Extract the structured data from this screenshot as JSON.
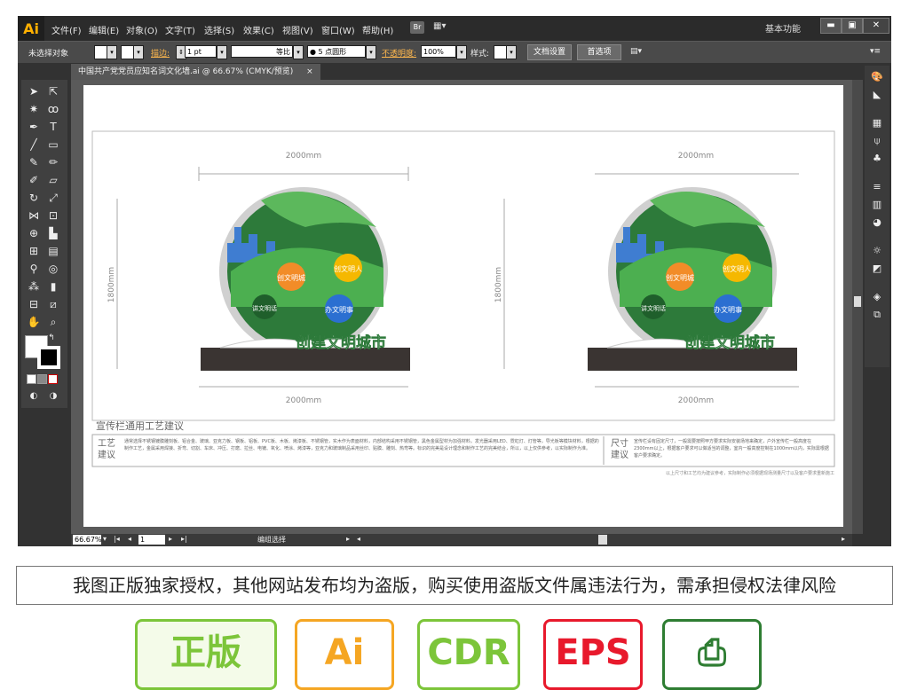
{
  "menubar": {
    "logo": "Ai",
    "items": [
      "文件(F)",
      "编辑(E)",
      "对象(O)",
      "文字(T)",
      "选择(S)",
      "效果(C)",
      "视图(V)",
      "窗口(W)",
      "帮助(H)"
    ],
    "br": "Br",
    "workspace": "基本功能",
    "minimize": "▬",
    "maximize": "▣",
    "close": "✕"
  },
  "control": {
    "selection_label": "未选择对象",
    "stroke_label": "描边:",
    "stroke_weight": "1 pt",
    "stroke_profile": "等比",
    "brush": "5 点圆形",
    "opacity_label": "不透明度:",
    "opacity_value": "100%",
    "style_label": "样式:",
    "doc_setup": "文档设置",
    "preferences": "首选项"
  },
  "tab": {
    "title": "中国共产党党员应知名词文化墙.ai @ 66.67% (CMYK/预览)",
    "close": "×"
  },
  "artwork": {
    "dim_width": "2000mm",
    "dim_height": "1800mm",
    "slogan": "创建文明城市",
    "circle_labels": [
      "创文明城",
      "创文明人",
      "讲文明话",
      "办文明事"
    ],
    "section_title": "宣传栏通用工艺建议",
    "craft_label": "工艺建议",
    "craft_text": "通常选择不锈钢镀膜雕刻板、铝合金、玻璃、亚克力板、钢板、铝板、PVC板、木板、烤漆板、不锈钢管，实木作为表面材料，内部结构采用不锈钢管，黑色金属型材为加强材料。发光器采用LED、霓虹灯、灯管等，导光板等模块材料，根据的制作工艺，金属采用焊接、折弯、切割、车床、冲压、打磨、拉丝、电镀、氧化、喷涂、烤漆等，亚克力和玻璃制品采用丝印、贴膜、雕刻、热弯等。标识的完美是设计理念和制作工艺的完美结合，所以，以上仅供参考，以实际制作为准。",
    "size_label": "尺寸建议",
    "size_text": "宣传栏设有固定尺寸，一般需要按照甲方要求实际安装场地来确定，户外宣传栏一般高度在2300mm以上，根据客户要求可以做适当的调整，室内一般高度控制在1000mm以内，实际需根据客户要求确定。",
    "footnote": "以上尺寸和工艺均为建议参考，实际制作必须根据现场测量尺寸以及客户要求重新施工"
  },
  "status": {
    "zoom": "66.67%",
    "page": "1",
    "mode": "编组选择"
  },
  "notice": "我图正版独家授权，其他网站发布均为盗版，购买使用盗版文件属违法行为，需承担侵权法律风险",
  "badges": [
    {
      "label": "正版",
      "color": "#7cc53a"
    },
    {
      "label": "Ai",
      "color": "#f5a623"
    },
    {
      "label": "CDR",
      "color": "#7cc53a"
    },
    {
      "label": "EPS",
      "color": "#e8192c"
    },
    {
      "label": "",
      "color": "#2e7d32"
    }
  ]
}
